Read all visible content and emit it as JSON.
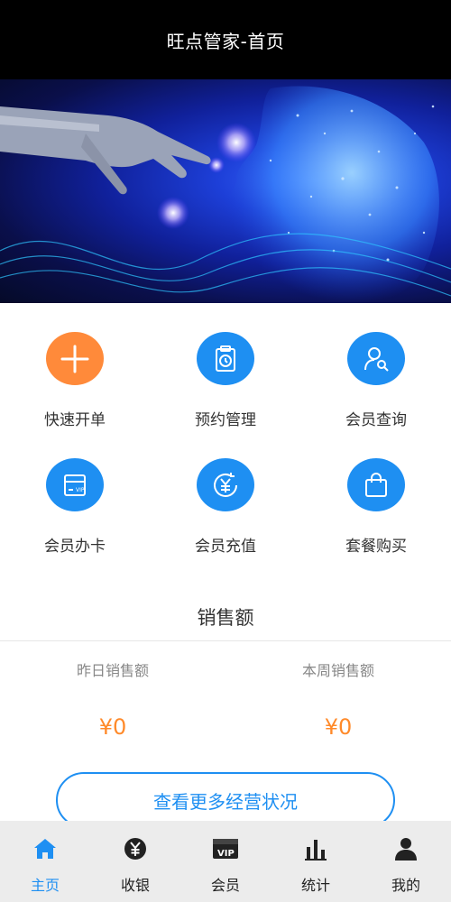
{
  "header": {
    "title": "旺点管家-首页"
  },
  "menu": [
    {
      "label": "快速开单",
      "icon": "plus-icon",
      "color": "#ff8a3a"
    },
    {
      "label": "预约管理",
      "icon": "clipboard-clock-icon",
      "color": "#1e8ff2"
    },
    {
      "label": "会员查询",
      "icon": "user-search-icon",
      "color": "#1e8ff2"
    },
    {
      "label": "会员办卡",
      "icon": "vip-card-icon",
      "color": "#1e8ff2"
    },
    {
      "label": "会员充值",
      "icon": "yen-recharge-icon",
      "color": "#1e8ff2"
    },
    {
      "label": "套餐购买",
      "icon": "shopping-bag-icon",
      "color": "#1e8ff2"
    }
  ],
  "sales": {
    "title": "销售额",
    "yesterday_label": "昨日销售额",
    "yesterday_value": "¥0",
    "week_label": "本周销售额",
    "week_value": "¥0",
    "more_button": "查看更多经营状况"
  },
  "tabs": [
    {
      "label": "主页",
      "icon": "home-icon",
      "active": true
    },
    {
      "label": "收银",
      "icon": "yen-coin-icon",
      "active": false
    },
    {
      "label": "会员",
      "icon": "vip-icon",
      "active": false
    },
    {
      "label": "统计",
      "icon": "bar-chart-icon",
      "active": false
    },
    {
      "label": "我的",
      "icon": "person-icon",
      "active": false
    }
  ],
  "colors": {
    "accent": "#1e8ff2",
    "orange": "#ff8a3a",
    "price": "#ff8a2a",
    "tabbar_bg": "#ececec"
  }
}
